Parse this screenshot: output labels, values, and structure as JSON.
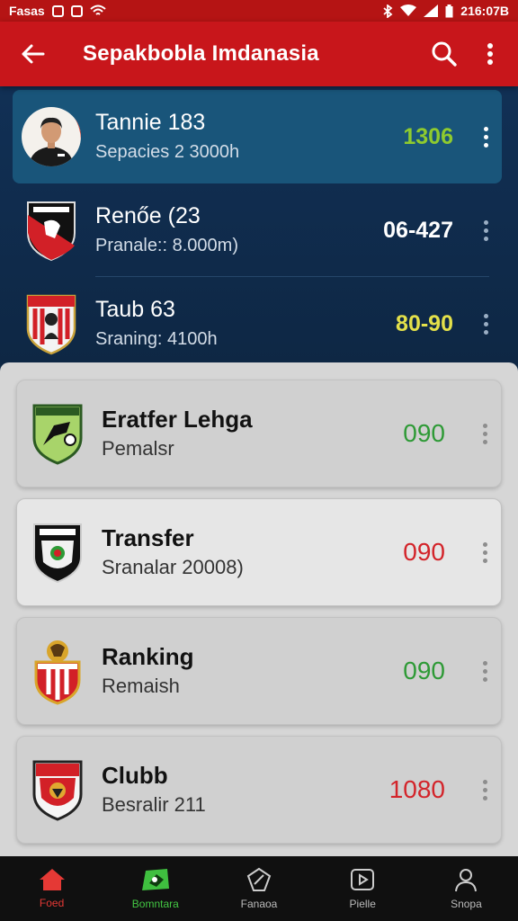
{
  "status_bar": {
    "left_text": "Fasas",
    "time": "216:07B"
  },
  "app_bar": {
    "title": "Sepakbobla Imdanasia"
  },
  "colors": {
    "app_bar": "#c8161b",
    "dark_bg": "#0f2a47",
    "selected_row": "#19557a",
    "value_green": "#8fcb2e",
    "value_yellow": "#e3e04a",
    "value_white": "#ffffff",
    "card_green": "#2e9a36",
    "card_red": "#d3242a"
  },
  "top_list": [
    {
      "title": "Tannie 183",
      "subtitle": "Sepacies 2 3000h",
      "value": "1306",
      "value_color": "#8fcb2e",
      "icon": "player-avatar"
    },
    {
      "title": "Renőe (23",
      "subtitle": "Pranale:: 8.000m)",
      "value": "06-427",
      "value_color": "#ffffff",
      "icon": "club-crest-red-black"
    },
    {
      "title": "Taub 63",
      "subtitle": "Sraning: 4100h",
      "value": "80-90",
      "value_color": "#e3e04a",
      "icon": "club-crest-red-white"
    }
  ],
  "cards": [
    {
      "title": "Eratfer Lehga",
      "subtitle": "Pemalsr",
      "value": "090",
      "value_color": "#2e9a36",
      "icon": "club-crest-green"
    },
    {
      "title": "Transfer",
      "subtitle": "Sranalar 20008)",
      "value": "090",
      "value_color": "#d3242a",
      "icon": "club-crest-black"
    },
    {
      "title": "Ranking",
      "subtitle": "Remaish",
      "value": "090",
      "value_color": "#2e9a36",
      "icon": "club-crest-garuda"
    },
    {
      "title": "Clubb",
      "subtitle": "Besralir 211",
      "value": "1080",
      "value_color": "#d3242a",
      "icon": "club-crest-red-shield"
    }
  ],
  "bottom_nav": [
    {
      "label": "Foed",
      "icon": "home-icon"
    },
    {
      "label": "Bomntara",
      "icon": "ball-icon"
    },
    {
      "label": "Fanaoa",
      "icon": "compass-icon"
    },
    {
      "label": "Pielle",
      "icon": "play-box-icon"
    },
    {
      "label": "Snopa",
      "icon": "profile-icon"
    }
  ]
}
